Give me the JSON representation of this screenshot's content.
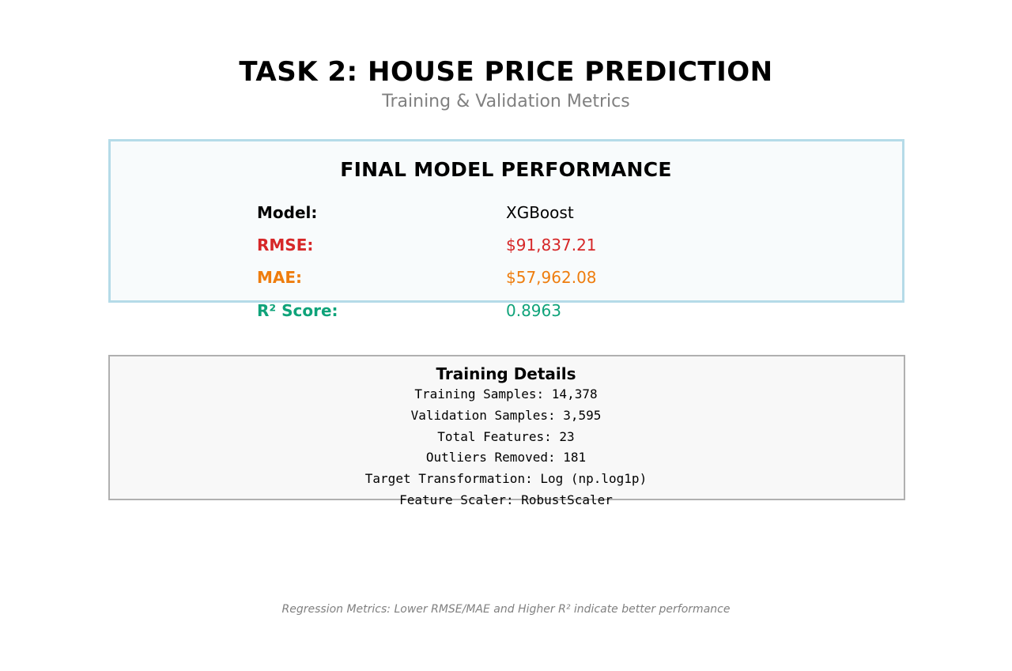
{
  "header": {
    "title": "TASK 2: HOUSE PRICE PREDICTION",
    "subtitle": "Training & Validation Metrics"
  },
  "performance": {
    "heading": "FINAL MODEL PERFORMANCE",
    "metrics": [
      {
        "label": "Model:",
        "value": "XGBoost",
        "color": "#000000"
      },
      {
        "label": "RMSE:",
        "value": "$91,837.21",
        "color": "#d62728"
      },
      {
        "label": "MAE:",
        "value": "$57,962.08",
        "color": "#ee7d0e"
      },
      {
        "label": "R² Score:",
        "value": "0.8963",
        "color": "#0fa37a"
      }
    ]
  },
  "training_details": {
    "heading": "Training Details",
    "lines": [
      "Training Samples: 14,378",
      "Validation Samples: 3,595",
      "Total Features: 23",
      "Outliers Removed: 181",
      "Target Transformation: Log (np.log1p)",
      "Feature Scaler: RobustScaler"
    ]
  },
  "footer": {
    "note": "Regression Metrics: Lower RMSE/MAE and Higher R² indicate better performance"
  },
  "colors": {
    "perf_border": "#add8e6",
    "details_border": "#b0b0b0",
    "muted_text": "#808080"
  }
}
